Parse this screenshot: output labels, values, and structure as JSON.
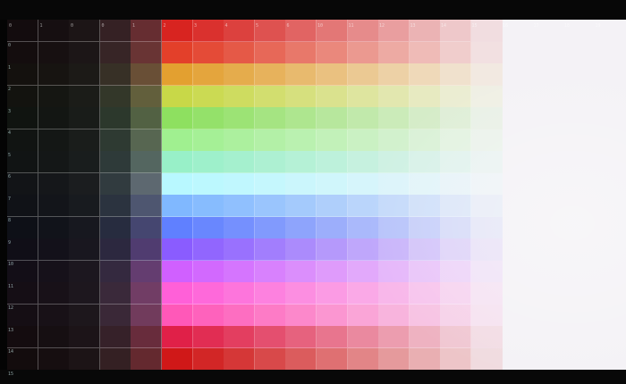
{
  "image": {
    "description_tags": [
      "color-grid",
      "monitor-photo"
    ],
    "grid": {
      "columns": 20,
      "rows": 16,
      "dark_columns": 5,
      "column_labels": [
        "0",
        "1",
        "0",
        "0",
        "1",
        "2",
        "3",
        "4",
        "5",
        "6",
        "10",
        "11",
        "12",
        "13",
        "14",
        "15",
        "16",
        "17",
        "18",
        "19",
        "20"
      ],
      "row_labels": [
        "0",
        "1",
        "2",
        "3",
        "4",
        "5",
        "6",
        "7",
        "8",
        "9",
        "10",
        "11",
        "12",
        "13",
        "14",
        "15"
      ]
    },
    "row_hues": [
      "#d82420",
      "#e3402a",
      "#e3a030",
      "#c8d848",
      "#8ee060",
      "#a0f090",
      "#98f0c8",
      "#b8f8ff",
      "#80b8ff",
      "#6080ff",
      "#8a5cff",
      "#d060ff",
      "#ff60d8",
      "#ff58b8",
      "#e02048",
      "#d01818"
    ],
    "dark_column_tints": [
      "#0b0b0d",
      "#0e0e10",
      "#141416",
      "#1f2125",
      "#3a3038"
    ],
    "fade_color": "#f4f2f6"
  }
}
